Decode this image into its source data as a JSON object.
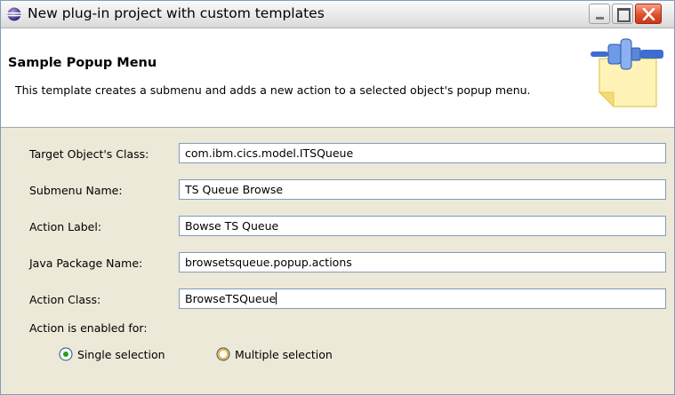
{
  "window": {
    "title": "New plug-in project with custom templates"
  },
  "banner": {
    "title": "Sample Popup Menu",
    "description": "This template creates a submenu and adds a new action to a selected object's popup menu."
  },
  "form": {
    "fields": [
      {
        "label": "Target Object's Class:",
        "value": "com.ibm.cics.model.ITSQueue"
      },
      {
        "label": "Submenu Name:",
        "value": "TS Queue Browse"
      },
      {
        "label": "Action Label:",
        "value": "Bowse TS Queue"
      },
      {
        "label": "Java Package Name:",
        "value": "browsetsqueue.popup.actions"
      },
      {
        "label": "Action Class:",
        "value": "BrowseTSQueue"
      }
    ],
    "enabled_label": "Action is enabled for:",
    "radios": [
      {
        "label": "Single selection",
        "checked": true
      },
      {
        "label": "Multiple selection",
        "checked": false
      }
    ]
  },
  "colors": {
    "window_bg": "#ece9d8",
    "input_border": "#7f9db9",
    "close_button": "#e0502c"
  }
}
